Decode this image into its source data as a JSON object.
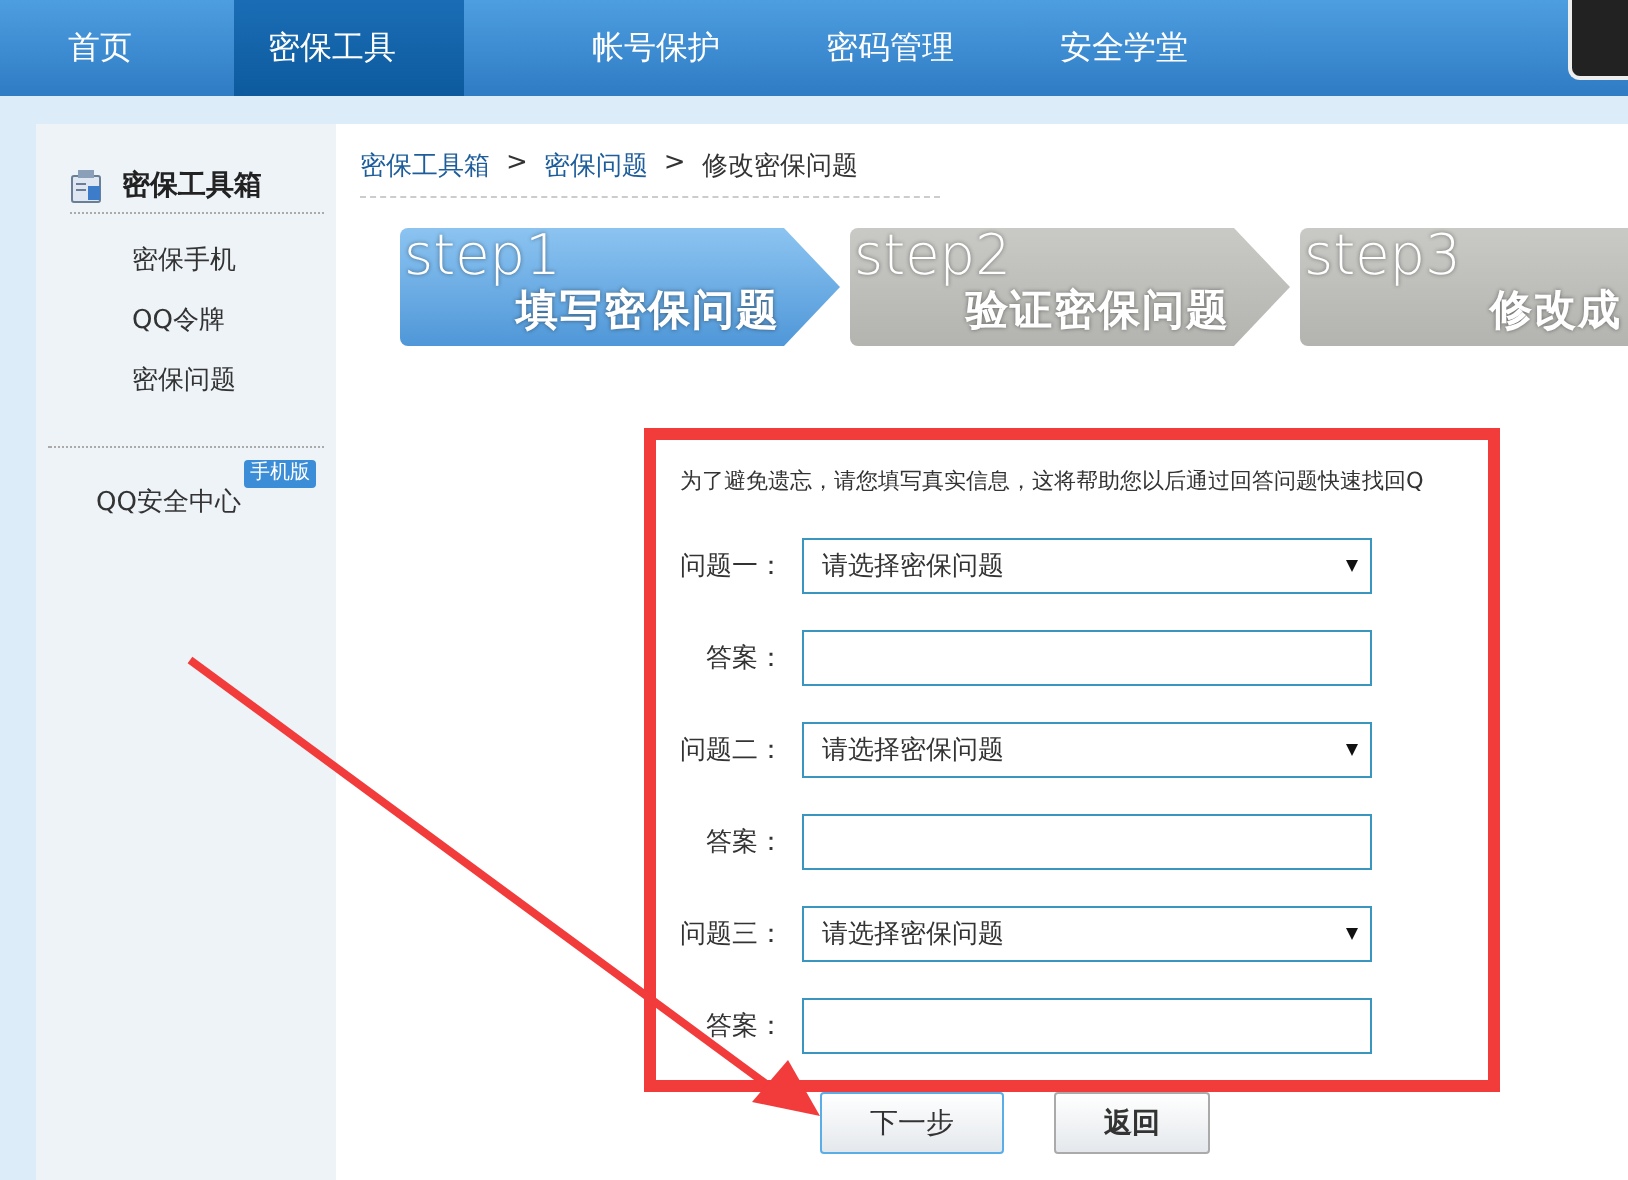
{
  "nav": {
    "tabs": [
      {
        "label": "首页",
        "selected": false
      },
      {
        "label": "密保工具",
        "selected": true
      },
      {
        "label": "帐号保护",
        "selected": false
      },
      {
        "label": "密码管理",
        "selected": false
      },
      {
        "label": "安全学堂",
        "selected": false
      }
    ]
  },
  "sidebar": {
    "title": "密保工具箱",
    "items": [
      "密保手机",
      "QQ令牌",
      "密保问题"
    ],
    "security_center": {
      "label": "QQ安全中心",
      "badge": "手机版"
    }
  },
  "breadcrumb": [
    {
      "kind": "link",
      "text": "密保工具箱"
    },
    {
      "kind": "separator",
      "text": ">"
    },
    {
      "kind": "link",
      "text": "密保问题"
    },
    {
      "kind": "separator",
      "text": ">"
    },
    {
      "kind": "current",
      "text": "修改密保问题"
    }
  ],
  "steps": [
    {
      "step": "step1",
      "title": "填写密保问题",
      "selected": true
    },
    {
      "step": "step2",
      "title": "验证密保问题",
      "selected": false
    },
    {
      "step": "step3",
      "title": "修改成",
      "selected": false
    }
  ],
  "form": {
    "intro": "为了避免遗忘，请您填写真实信息，这将帮助您以后通过回答问题快速找回Q",
    "rows": [
      {
        "kind": "select",
        "label": "问题一：",
        "value": "请选择密保问题"
      },
      {
        "kind": "text",
        "label": "答案："
      },
      {
        "kind": "select",
        "label": "问题二：",
        "value": "请选择密保问题"
      },
      {
        "kind": "text",
        "label": "答案："
      },
      {
        "kind": "select",
        "label": "问题三：",
        "value": "请选择密保问题"
      },
      {
        "kind": "text",
        "label": "答案："
      }
    ]
  },
  "buttons": [
    {
      "kind": "primary",
      "label": "下一步"
    },
    {
      "kind": "secondary",
      "label": "返回"
    }
  ]
}
